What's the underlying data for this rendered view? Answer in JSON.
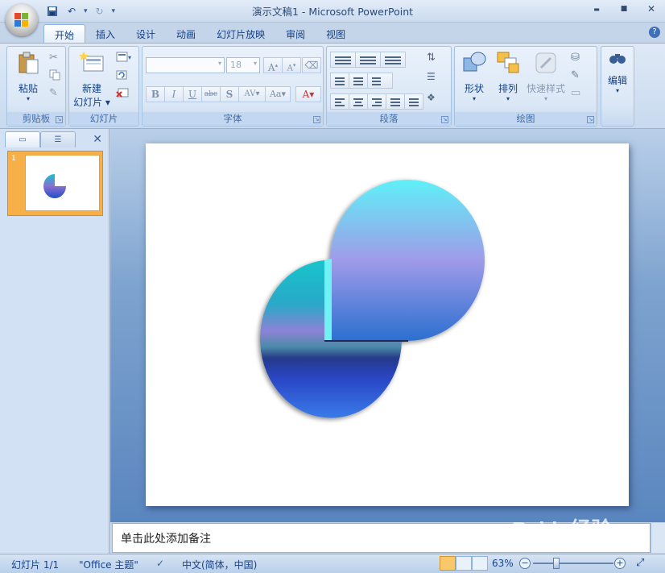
{
  "window": {
    "title": "演示文稿1 - Microsoft PowerPoint",
    "minimize": "▬",
    "maximize": "■",
    "close": "✕"
  },
  "ribbon": {
    "tabs": [
      {
        "label": "开始",
        "active": true
      },
      {
        "label": "插入"
      },
      {
        "label": "设计"
      },
      {
        "label": "动画"
      },
      {
        "label": "幻灯片放映"
      },
      {
        "label": "审阅"
      },
      {
        "label": "视图"
      }
    ],
    "help": "?",
    "groups": {
      "clipboard": {
        "label": "剪贴板",
        "paste": "粘贴"
      },
      "slides": {
        "label": "幻灯片",
        "new_slide_line1": "新建",
        "new_slide_line2": "幻灯片"
      },
      "font": {
        "label": "字体",
        "font_name": "",
        "font_size": "18"
      },
      "paragraph": {
        "label": "段落"
      },
      "drawing": {
        "label": "绘图",
        "shapes": "形状",
        "arrange": "排列",
        "quick_styles": "快速样式"
      },
      "editing": {
        "label": "编辑"
      }
    }
  },
  "panel": {
    "slide_number": "1"
  },
  "notes": {
    "placeholder": "单击此处添加备注"
  },
  "status": {
    "slide_info": "幻灯片 1/1",
    "theme": "\"Office 主题\"",
    "language": "中文(简体，中国)",
    "zoom": "63%"
  },
  "watermark": "Baidu经验",
  "colors": {
    "accent_blue": "#15428b",
    "ribbon_bg": "#dfe9f6",
    "selected_thumb": "#f7b048",
    "pie_top": "#17c3d0",
    "pie_mid": "#8a6fcf",
    "pie_bottom": "#1f4ec8"
  }
}
